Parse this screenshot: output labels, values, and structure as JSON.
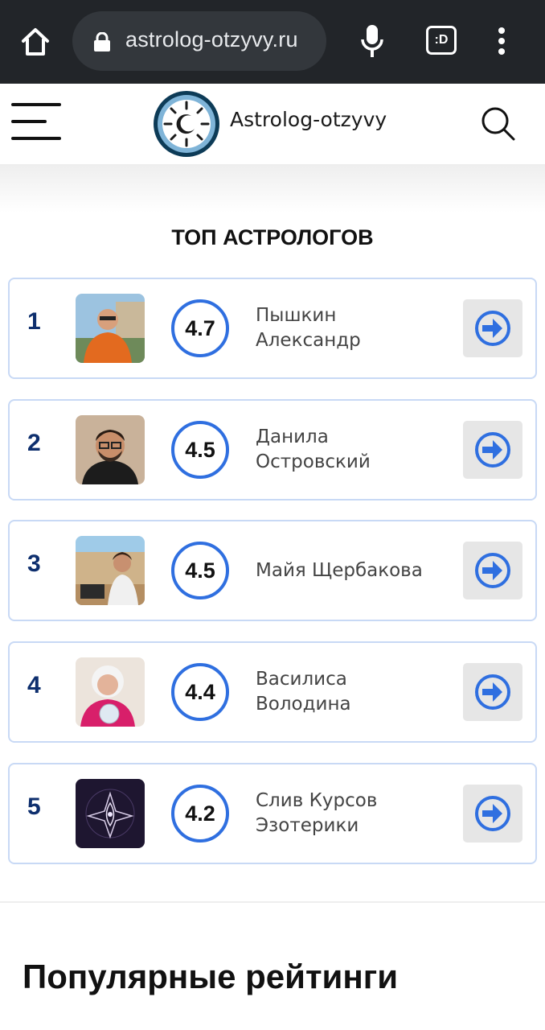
{
  "browser": {
    "url": "astrolog-otzyvy.ru",
    "tabs_label": ":D"
  },
  "header": {
    "brand": "Astrolog-otzyvy"
  },
  "section": {
    "title": "ТОП АСТРОЛОГОВ"
  },
  "astrologers": [
    {
      "rank": "1",
      "rating": "4.7",
      "name_line1": "Пышкин",
      "name_line2": "Александр"
    },
    {
      "rank": "2",
      "rating": "4.5",
      "name_line1": "Данила",
      "name_line2": "Островский"
    },
    {
      "rank": "3",
      "rating": "4.5",
      "name_line1": "Майя Щербакова",
      "name_line2": ""
    },
    {
      "rank": "4",
      "rating": "4.4",
      "name_line1": "Василиса",
      "name_line2": "Володина"
    },
    {
      "rank": "5",
      "rating": "4.2",
      "name_line1": "Слив Курсов",
      "name_line2": "Эзотерики"
    }
  ],
  "popular": {
    "title": "Популярные рейтинги"
  },
  "colors": {
    "accent": "#2f6fe0",
    "rank": "#0e2f6e",
    "card_border": "#c8d9f5",
    "browser_bg": "#222529"
  },
  "icons": [
    "home-icon",
    "lock-icon",
    "mic-icon",
    "menu-dots-icon",
    "hamburger-icon",
    "logo-icon",
    "search-icon",
    "arrow-right-circle-icon"
  ]
}
